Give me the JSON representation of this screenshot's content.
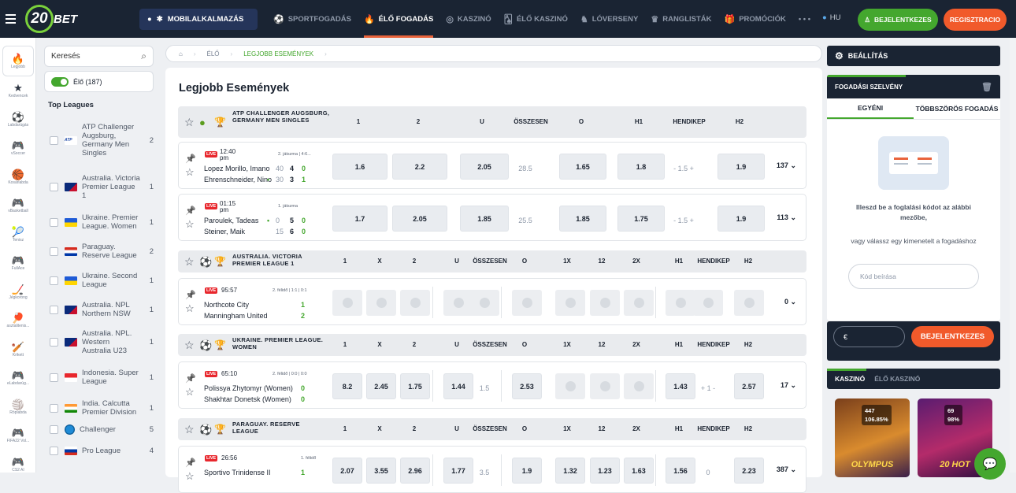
{
  "header": {
    "logo_num": "20",
    "logo_text": "BET",
    "mobile_app": "MOBILALKALMAZÁS",
    "nav": [
      {
        "label": "SPORTFOGADÁS",
        "icon": "soccer-icon",
        "active": false
      },
      {
        "label": "ÉLŐ FOGADÁS",
        "icon": "fire-icon",
        "active": true
      },
      {
        "label": "KASZINÓ",
        "icon": "casino-icon",
        "active": false
      },
      {
        "label": "ÉLŐ KASZINÓ",
        "icon": "cards-icon",
        "active": false
      },
      {
        "label": "LÓVERSENY",
        "icon": "horse-icon",
        "active": false
      },
      {
        "label": "RANGLISTÁK",
        "icon": "trophy-icon",
        "active": false
      },
      {
        "label": "PROMÓCIÓK",
        "icon": "gift-icon",
        "active": false
      }
    ],
    "more": "• • •",
    "lang": "HU",
    "login": "BEJELENTKEZES",
    "register": "REGISZTRACIO"
  },
  "sports": [
    {
      "label": "Legjobb",
      "glyph": "🔥"
    },
    {
      "label": "Kedvencek",
      "glyph": "★"
    },
    {
      "label": "Labdarúgás",
      "glyph": "⚽"
    },
    {
      "label": "vSoccer",
      "glyph": "🎮"
    },
    {
      "label": "Kosárlabda",
      "glyph": "🏀"
    },
    {
      "label": "vBasketball",
      "glyph": "🎮"
    },
    {
      "label": "Tenisz",
      "glyph": "🎾"
    },
    {
      "label": "FullAce",
      "glyph": "🎮"
    },
    {
      "label": "Jégkorong",
      "glyph": "🏒"
    },
    {
      "label": "asztalitenis...",
      "glyph": "🏓"
    },
    {
      "label": "Krikett",
      "glyph": "🏏"
    },
    {
      "label": "eLabdarúg...",
      "glyph": "🎮"
    },
    {
      "label": "Röplabda",
      "glyph": "🏐"
    },
    {
      "label": "FIFA22 Vol...",
      "glyph": "🎮"
    },
    {
      "label": "CS2 AI",
      "glyph": "🎮"
    }
  ],
  "sidebar": {
    "search_placeholder": "Keresés",
    "live_label": "Élő (187)",
    "top_leagues": "Top Leagues",
    "leagues": [
      {
        "name": "ATP Challenger Augsburg, Germany Men Singles",
        "count": "2",
        "flag": "atp"
      },
      {
        "name": "Australia. Victoria Premier League 1",
        "count": "1",
        "flag": "au"
      },
      {
        "name": "Ukraine. Premier League. Women",
        "count": "1",
        "flag": "ua"
      },
      {
        "name": "Paraguay. Reserve League",
        "count": "2",
        "flag": "py"
      },
      {
        "name": "Ukraine. Second League",
        "count": "1",
        "flag": "ua"
      },
      {
        "name": "Australia. NPL Northern NSW",
        "count": "1",
        "flag": "au"
      },
      {
        "name": "Australia. NPL. Western Australia U23",
        "count": "1",
        "flag": "au"
      },
      {
        "name": "Indonesia. Super League",
        "count": "1",
        "flag": "id"
      },
      {
        "name": "India. Calcutta Premier Division",
        "count": "1",
        "flag": "in"
      },
      {
        "name": "Challenger",
        "count": "5",
        "flag": "globe"
      },
      {
        "name": "Pro League",
        "count": "4",
        "flag": "ru"
      }
    ]
  },
  "breadcrumb": {
    "live": "ÉLŐ",
    "current": "LEGJOBB ESEMÉNYEK"
  },
  "main": {
    "title": "Legjobb Események",
    "live_badge": "LIVE",
    "groups": [
      {
        "league": "ATP CHALLENGER AUGSBURG, GERMANY MEN SINGLES",
        "cols": [
          "1",
          "2",
          "U",
          "ÖSSZESEN",
          "O",
          "H1",
          "HENDIKEP",
          "H2"
        ],
        "matches": [
          {
            "time": "12:40 pm",
            "period": "2. játszma | 4:6...",
            "home": "Lopez Morillo, Imano",
            "away": "Ehrenschneider, Nino",
            "hs": [
              "40",
              "4",
              "0"
            ],
            "as": [
              "30",
              "3",
              "1"
            ],
            "odds": [
              "1.6",
              "2.2",
              "2.05",
              "28.5",
              "1.65",
              "1.8",
              "- 1.5 +",
              "1.9"
            ],
            "more": "137"
          },
          {
            "time": "01:15 pm",
            "period": "1. játszma",
            "home": "Paroulek, Tadeas",
            "away": "Steiner, Maik",
            "hs": [
              "0",
              "5",
              "0"
            ],
            "as": [
              "15",
              "6",
              "0"
            ],
            "odds": [
              "1.7",
              "2.05",
              "1.85",
              "25.5",
              "1.85",
              "1.75",
              "- 1.5 +",
              "1.9"
            ],
            "more": "113"
          }
        ]
      },
      {
        "league": "AUSTRALIA. VICTORIA PREMIER LEAGUE 1",
        "cols": [
          "1",
          "X",
          "2",
          "U",
          "ÖSSZESEN",
          "O",
          "1X",
          "12",
          "2X",
          "H1",
          "HENDIKEP",
          "H2"
        ],
        "matches": [
          {
            "time": "95:57",
            "period": "2. félidő | 1:1 | 0:1",
            "home": "Northcote City",
            "away": "Manningham United",
            "hs": [
              "1"
            ],
            "as": [
              "2"
            ],
            "more": "0"
          }
        ]
      },
      {
        "league": "UKRAINE. PREMIER LEAGUE. WOMEN",
        "cols": [
          "1",
          "X",
          "2",
          "U",
          "ÖSSZESEN",
          "O",
          "1X",
          "12",
          "2X",
          "H1",
          "HENDIKEP",
          "H2"
        ],
        "matches": [
          {
            "time": "65:10",
            "period": "2. félidő | 0:0 | 0:0",
            "home": "Polissya Zhytomyr (Women)",
            "away": "Shakhtar Donetsk (Women)",
            "hs": [
              "0"
            ],
            "as": [
              "0"
            ],
            "odds": [
              "8.2",
              "2.45",
              "1.75",
              "1.44",
              "1.5",
              "2.53",
              "1.43",
              "+ 1 -",
              "2.57"
            ],
            "more": "17"
          }
        ]
      },
      {
        "league": "PARAGUAY. RESERVE LEAGUE",
        "cols": [
          "1",
          "X",
          "2",
          "U",
          "ÖSSZESEN",
          "O",
          "1X",
          "12",
          "2X",
          "H1",
          "HENDIKEP",
          "H2"
        ],
        "matches": [
          {
            "time": "26:56",
            "period": "1. félidő",
            "home": "Sportivo Trinidense II",
            "away": "",
            "hs": [
              "1"
            ],
            "as": [
              ""
            ],
            "odds": [
              "2.07",
              "3.55",
              "2.96",
              "1.77",
              "3.5",
              "1.9",
              "1.32",
              "1.23",
              "1.63",
              "1.56",
              "0",
              "2.23"
            ],
            "more": "387"
          }
        ]
      }
    ]
  },
  "right": {
    "settings": "BEÁLLÍTÁS",
    "slip_title": "FOGADÁSI SZELVÉNY",
    "tab_single": "EGYÉNI",
    "tab_multi": "TÖBBSZÖRÖS FOGADÁS",
    "hint1": "Illeszd be a foglalási kódot az alábbi mezőbe,",
    "hint2": "vagy válassz egy kimenetelt a fogadáshoz",
    "code_placeholder": "Kód beírása",
    "currency": "€",
    "login": "BEJELENTKEZES",
    "casino": "KASZINÓ",
    "live_casino": "ÉLŐ KASZINÓ",
    "games": [
      {
        "name": "OLYMPUS",
        "players": "447",
        "rtp": "106.85%"
      },
      {
        "name": "20 HOT",
        "players": "69",
        "rtp": "98%"
      }
    ]
  }
}
